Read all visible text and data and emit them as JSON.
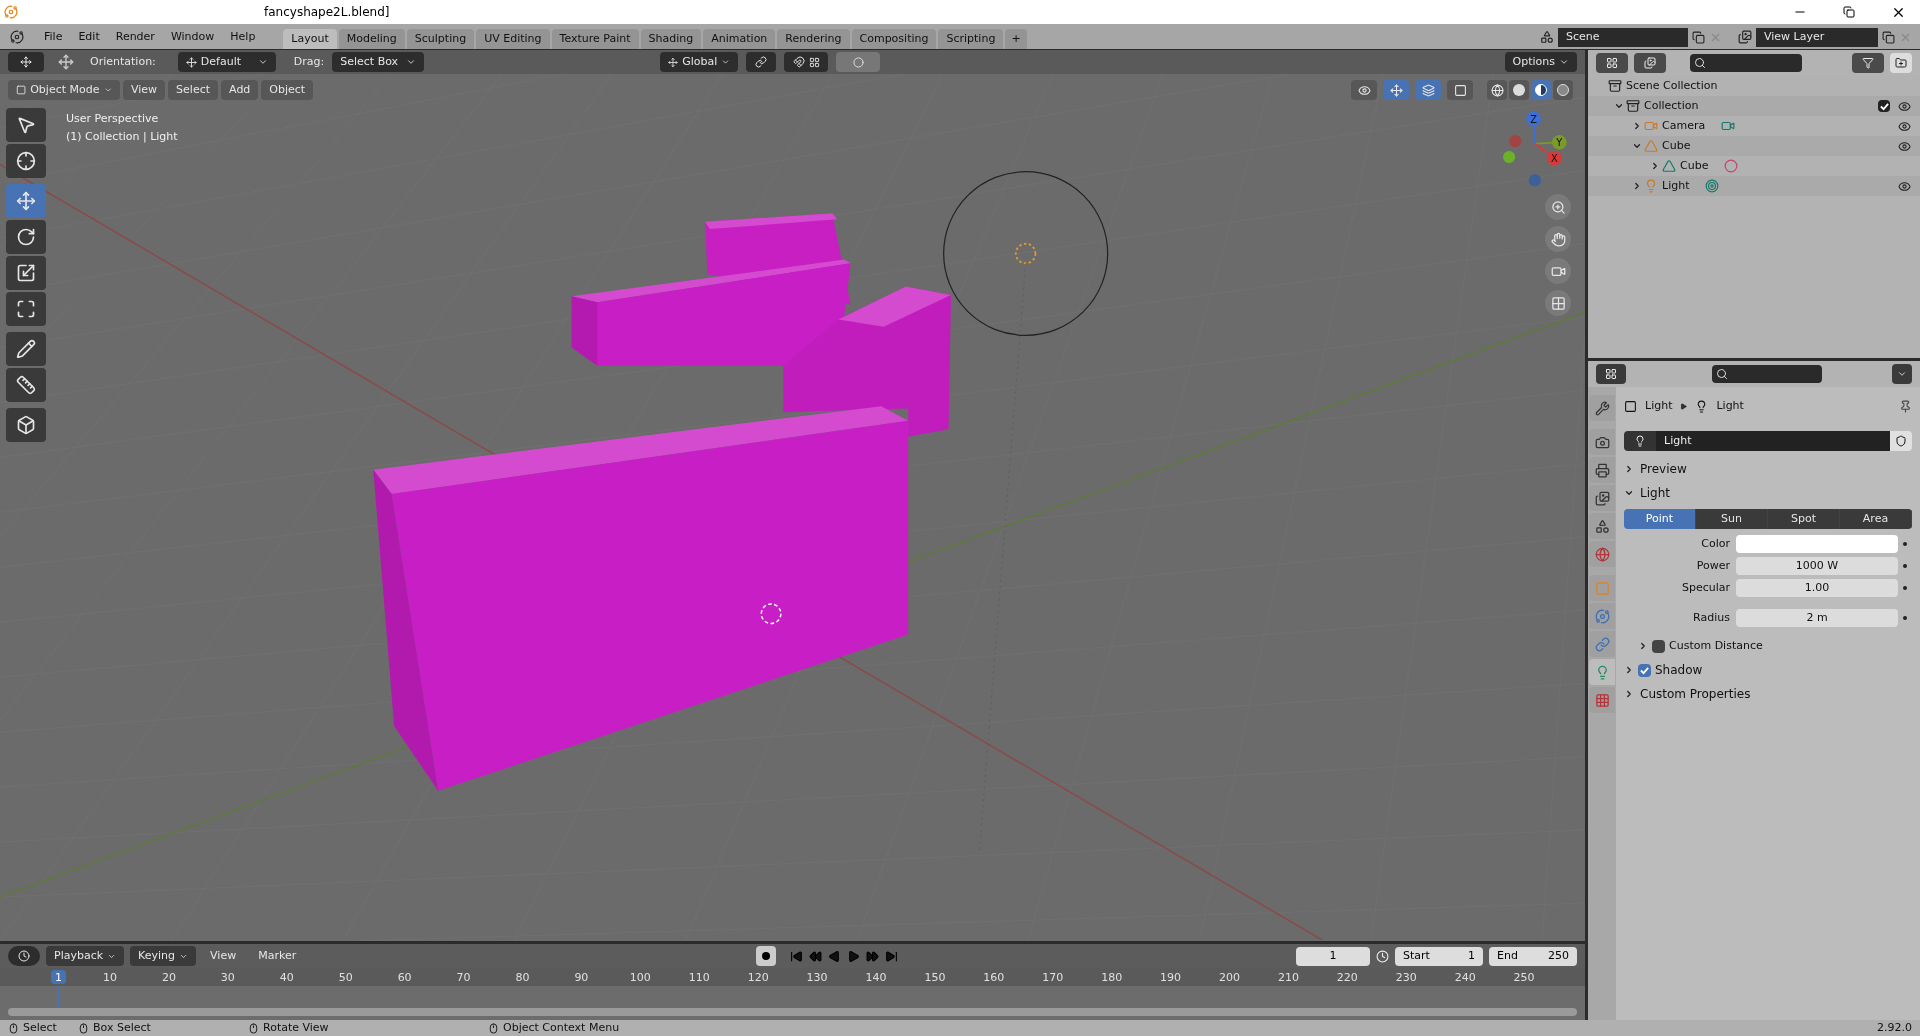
{
  "window": {
    "title": "fancyshape2L.blend]"
  },
  "menu": [
    "File",
    "Edit",
    "Render",
    "Window",
    "Help"
  ],
  "workspaces": [
    {
      "label": "Layout",
      "selected": true
    },
    {
      "label": "Modeling",
      "selected": false
    },
    {
      "label": "Sculpting",
      "selected": false
    },
    {
      "label": "UV Editing",
      "selected": false
    },
    {
      "label": "Texture Paint",
      "selected": false
    },
    {
      "label": "Shading",
      "selected": false
    },
    {
      "label": "Animation",
      "selected": false
    },
    {
      "label": "Rendering",
      "selected": false
    },
    {
      "label": "Compositing",
      "selected": false
    },
    {
      "label": "Scripting",
      "selected": false
    }
  ],
  "add_workspace": "+",
  "scene": "Scene",
  "view_layer": "View Layer",
  "tool_header": {
    "orientation_label": "Orientation:",
    "orientation": "Default",
    "drag_label": "Drag:",
    "drag": "Select Box",
    "transform": "Global",
    "options": "Options"
  },
  "viewport_header": {
    "mode": "Object Mode",
    "menus": [
      "View",
      "Select",
      "Add",
      "Object"
    ]
  },
  "viewport_toggles": [
    {
      "kind": "selectability",
      "selected": false
    },
    {
      "kind": "gizmo",
      "selected": true
    },
    {
      "kind": "overlays",
      "selected": true
    },
    {
      "kind": "xray",
      "selected": false
    }
  ],
  "shading": [
    {
      "kind": "wireframe",
      "selected": false
    },
    {
      "kind": "solid",
      "selected": false
    },
    {
      "kind": "material",
      "selected": true
    },
    {
      "kind": "rendered",
      "selected": false
    }
  ],
  "toolbar": [
    {
      "kind": "select",
      "selected": false
    },
    {
      "kind": "cursor",
      "selected": false
    },
    {
      "kind": "move",
      "selected": true
    },
    {
      "kind": "rotate",
      "selected": false
    },
    {
      "kind": "scale",
      "selected": false
    },
    {
      "kind": "transform",
      "selected": false
    },
    {
      "kind": "annotate",
      "selected": false
    },
    {
      "kind": "measure",
      "selected": false
    },
    {
      "kind": "add-cube",
      "selected": false
    }
  ],
  "viewport": {
    "lines": [
      "User Perspective",
      "(1) Collection | Light"
    ],
    "gizmo_axes": [
      "Z",
      "Y",
      "X"
    ]
  },
  "outliner": {
    "items": [
      {
        "label": "Scene Collection",
        "kind": "collection",
        "visible": false,
        "children": [
          {
            "label": "Collection",
            "kind": "collection",
            "expanded": true,
            "checked": true,
            "visible": true,
            "children": [
              {
                "label": "Camera",
                "kind": "camera",
                "expanded": false,
                "visible": true
              },
              {
                "label": "Cube",
                "kind": "object-mesh",
                "expanded": true,
                "visible": true,
                "children": [
                  {
                    "label": "Cube",
                    "kind": "mesh",
                    "expanded": false,
                    "visible": false
                  }
                ]
              },
              {
                "label": "Light",
                "kind": "light",
                "expanded": false,
                "visible": true
              }
            ]
          }
        ]
      }
    ]
  },
  "properties": {
    "tabs": [
      {
        "kind": "tool",
        "selected": false
      },
      {
        "kind": "render",
        "selected": false
      },
      {
        "kind": "output",
        "selected": false
      },
      {
        "kind": "view-layer",
        "selected": false
      },
      {
        "kind": "scene",
        "selected": false
      },
      {
        "kind": "world",
        "selected": false
      },
      {
        "kind": "object",
        "selected": false
      },
      {
        "kind": "physics",
        "selected": false
      },
      {
        "kind": "constraints",
        "selected": false
      },
      {
        "kind": "data",
        "selected": true
      },
      {
        "kind": "texture",
        "selected": false
      }
    ],
    "breadcrumb": [
      "Light",
      "Light"
    ],
    "datablock": "Light",
    "preview": {
      "label": "Preview",
      "expanded": false
    },
    "light": {
      "label": "Light",
      "expanded": true,
      "types": [
        {
          "label": "Point",
          "selected": true
        },
        {
          "label": "Sun",
          "selected": false
        },
        {
          "label": "Spot",
          "selected": false
        },
        {
          "label": "Area",
          "selected": false
        }
      ],
      "fields": [
        {
          "label": "Color",
          "kind": "color",
          "color": "#ffffff"
        },
        {
          "label": "Power",
          "kind": "value",
          "value": "1000 W"
        },
        {
          "label": "Specular",
          "kind": "value",
          "value": "1.00"
        },
        {
          "label": "Radius",
          "kind": "value",
          "value": "2 m"
        }
      ],
      "custom_distance": {
        "label": "Custom Distance",
        "expanded": false,
        "checked": false
      }
    },
    "shadow": {
      "label": "Shadow",
      "expanded": false,
      "checked": true
    },
    "custom_properties": {
      "label": "Custom Properties",
      "expanded": false
    }
  },
  "timeline": {
    "menus": [
      "Playback",
      "Keying",
      "View",
      "Marker"
    ],
    "current_frame": "1",
    "start_label": "Start",
    "start": "1",
    "end_label": "End",
    "end": "250",
    "ruler": [
      "1",
      "10",
      "20",
      "30",
      "40",
      "50",
      "60",
      "70",
      "80",
      "90",
      "100",
      "110",
      "120",
      "130",
      "140",
      "150",
      "160",
      "170",
      "180",
      "190",
      "200",
      "210",
      "220",
      "230",
      "240",
      "250"
    ]
  },
  "status_bar": {
    "items": [
      "Select",
      "Box Select",
      "Rotate View",
      "Object Context Menu"
    ],
    "version": "2.92.0"
  }
}
